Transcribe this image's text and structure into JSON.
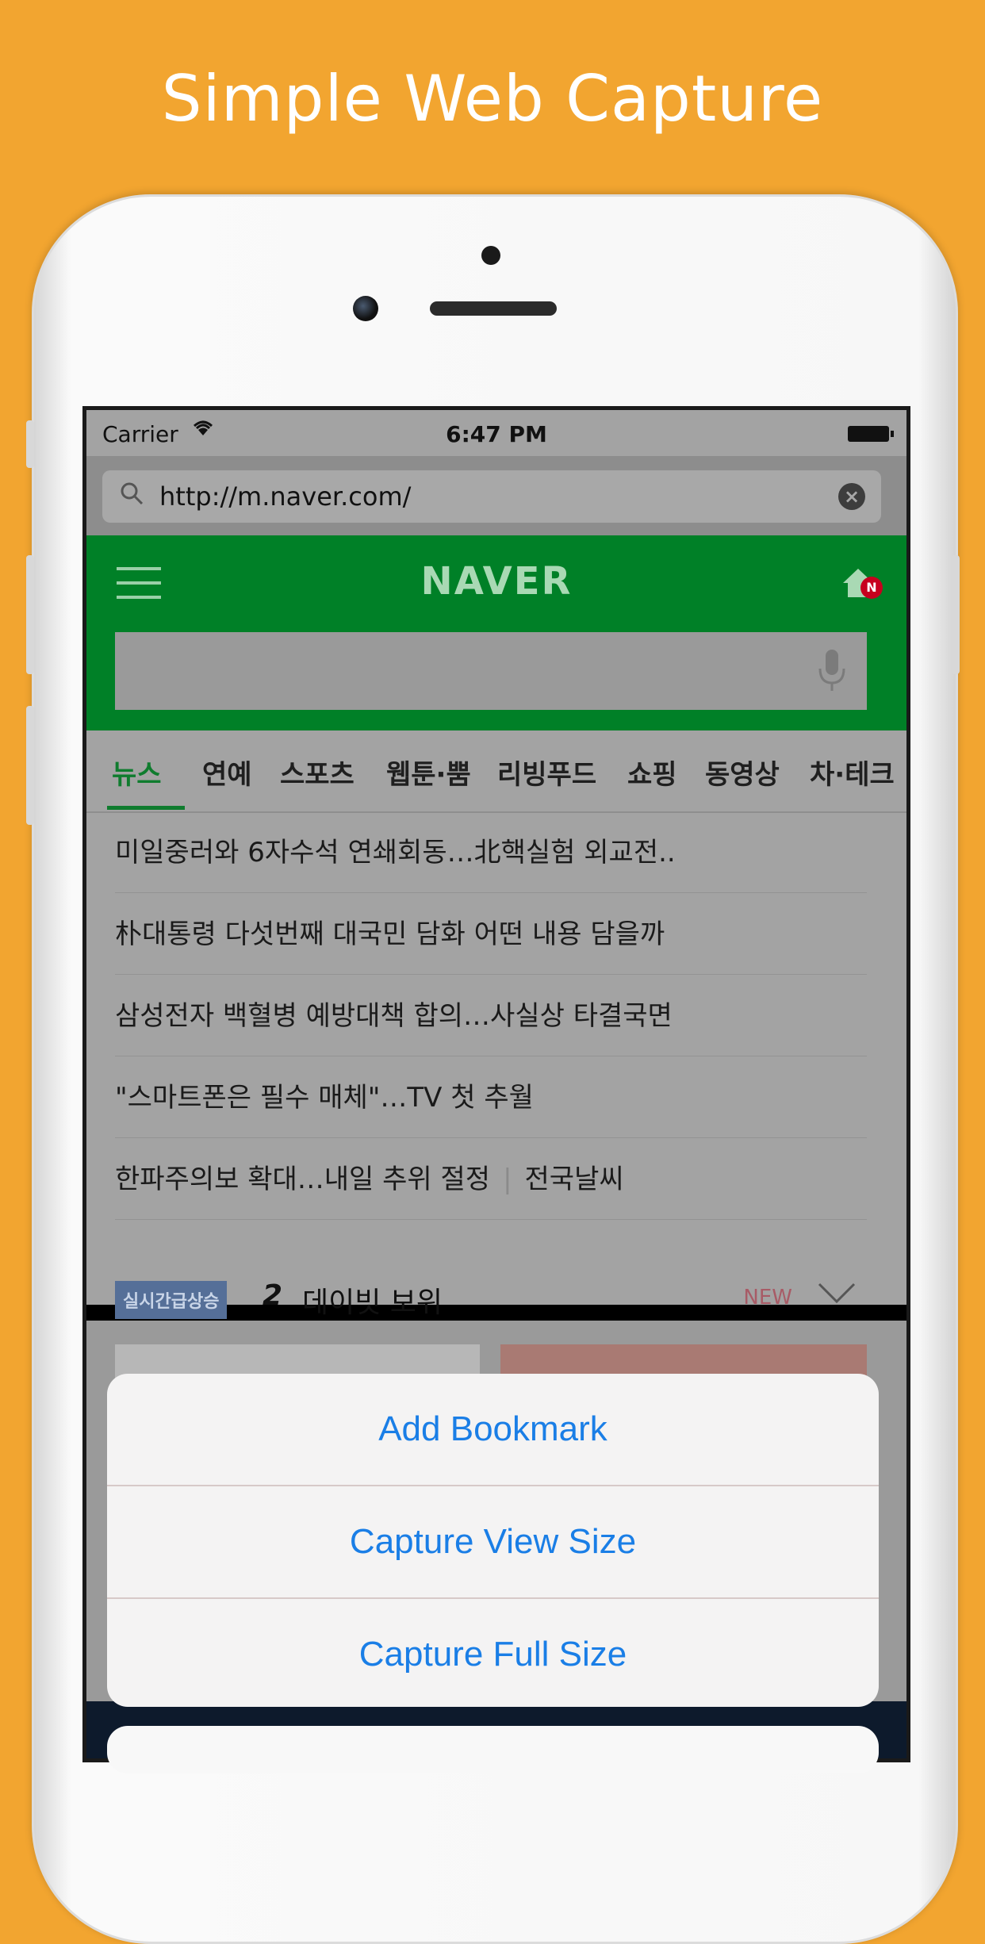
{
  "headline": "Simple Web Capture",
  "status_bar": {
    "carrier": "Carrier",
    "time": "6:47 PM"
  },
  "browser": {
    "url": "http://m.naver.com/"
  },
  "naver": {
    "logo": "NAVER",
    "home_badge": "N",
    "tabs": [
      {
        "label": "뉴스"
      },
      {
        "label": "연예"
      },
      {
        "label": "스포츠"
      },
      {
        "label": "웹툰·뿜"
      },
      {
        "label": "리빙푸드"
      },
      {
        "label": "쇼핑"
      },
      {
        "label": "동영상"
      },
      {
        "label": "차·테크"
      }
    ],
    "news": [
      "미일중러와 6자수석 연쇄회동…北핵실험 외교전..",
      "朴대통령 다섯번째 대국민 담화 어떤 내용 담을까",
      "삼성전자 백혈병 예방대책 합의…사실상 타결국면",
      "\"스마트폰은 필수 매체\"…TV 첫 추월",
      "한파주의보 확대…내일 추위 절정"
    ],
    "news_extra": "전국날씨",
    "trending": {
      "badge": "실시간급상승",
      "rank": "2",
      "text": "데이빗 보위",
      "new_label": "NEW"
    }
  },
  "action_sheet": {
    "add_bookmark": "Add Bookmark",
    "capture_view": "Capture View Size",
    "capture_full": "Capture Full Size"
  },
  "colors": {
    "background": "#f2a530",
    "naver_green": "#008027",
    "ios_blue": "#1a7ee6"
  }
}
